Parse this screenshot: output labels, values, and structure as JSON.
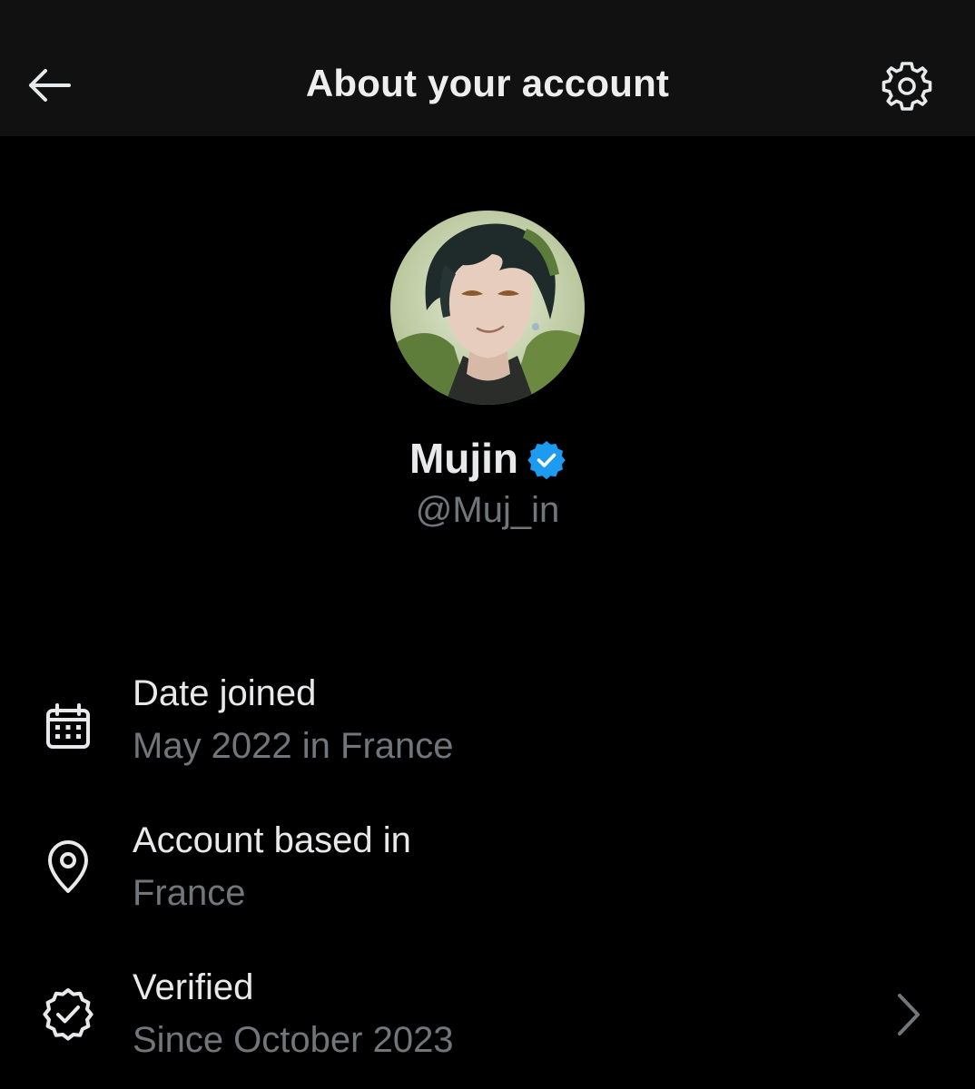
{
  "header": {
    "title": "About your account",
    "back_icon": "arrow-left-icon",
    "settings_icon": "gear-icon"
  },
  "profile": {
    "display_name": "Mujin",
    "handle": "@Muj_in",
    "verified": true,
    "badge_color": "#1d9bf0"
  },
  "info": [
    {
      "icon": "calendar-icon",
      "label": "Date joined",
      "value": "May 2022 in France"
    },
    {
      "icon": "location-pin-icon",
      "label": "Account based in",
      "value": "France"
    },
    {
      "icon": "verified-check-icon",
      "label": "Verified",
      "value": "Since October 2023"
    }
  ],
  "colors": {
    "background": "#000000",
    "header_background": "#111111",
    "primary_text": "#e7e9ea",
    "secondary_text": "#71767b",
    "accent": "#1d9bf0"
  }
}
